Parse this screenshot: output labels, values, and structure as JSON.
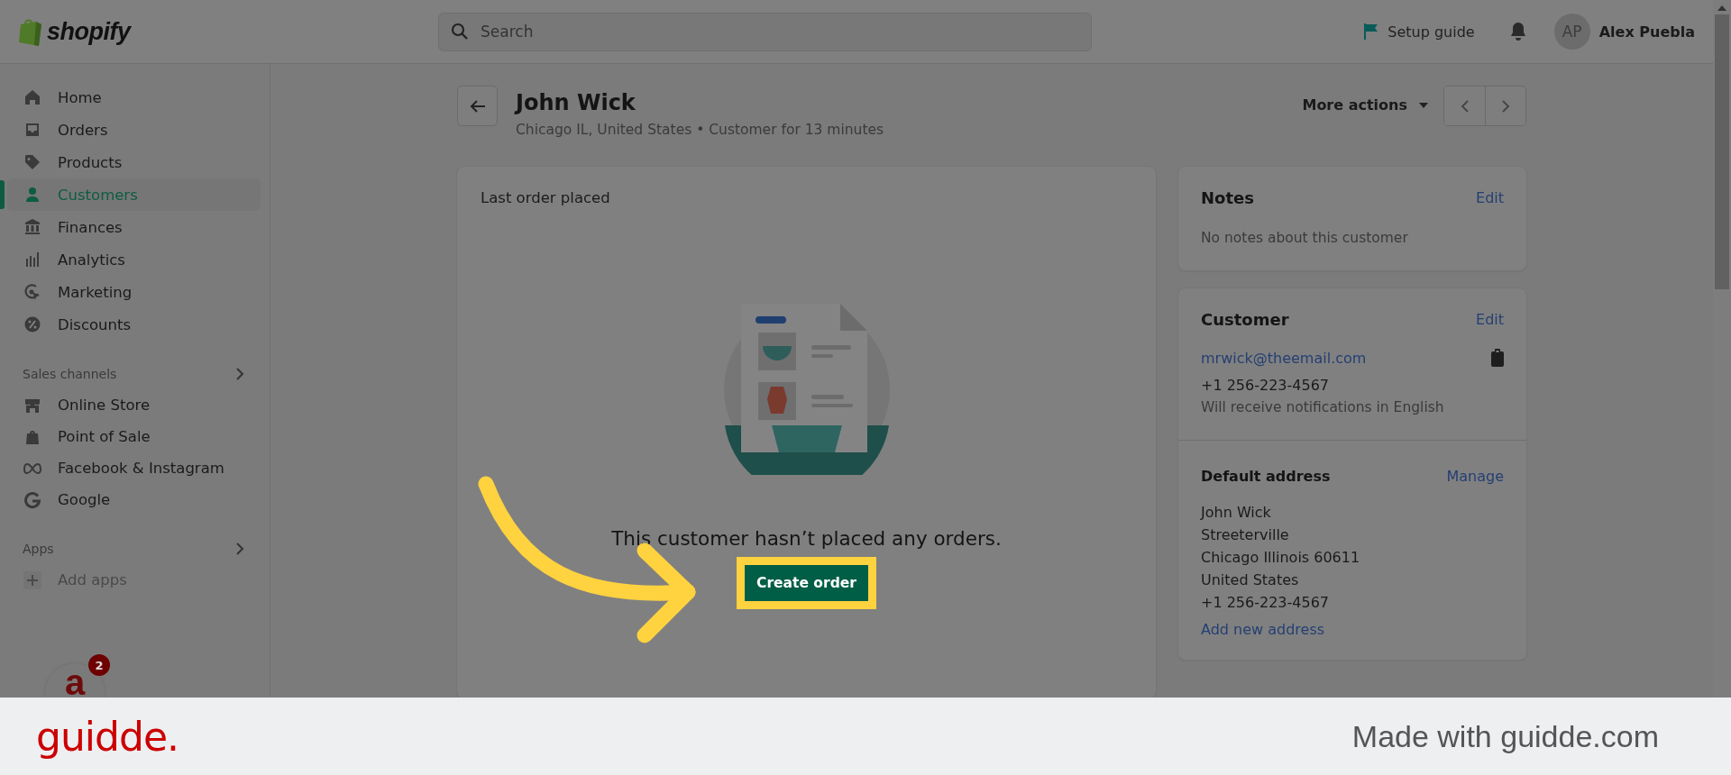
{
  "top_bar": {
    "logo": "shopify",
    "search": {
      "placeholder": "Search"
    },
    "setup_guide": "Setup guide",
    "user": {
      "initials": "AP",
      "name": "Alex Puebla"
    }
  },
  "sidebar": {
    "items": [
      {
        "label": "Home",
        "selected": false
      },
      {
        "label": "Orders",
        "selected": false
      },
      {
        "label": "Products",
        "selected": false
      },
      {
        "label": "Customers",
        "selected": true
      },
      {
        "label": "Finances",
        "selected": false
      },
      {
        "label": "Analytics",
        "selected": false
      },
      {
        "label": "Marketing",
        "selected": false
      },
      {
        "label": "Discounts",
        "selected": false
      }
    ],
    "sections": [
      {
        "title": "Sales channels",
        "items": [
          {
            "label": "Online Store",
            "kind": "link"
          },
          {
            "label": "Point of Sale",
            "kind": "link"
          },
          {
            "label": "Facebook & Instagram",
            "kind": "link"
          },
          {
            "label": "Google",
            "kind": "link"
          }
        ]
      },
      {
        "title": "Apps",
        "items": [
          {
            "label": "Add apps",
            "kind": "add"
          }
        ]
      }
    ]
  },
  "page_header": {
    "title": "John Wick",
    "subtitle": "Chicago IL, United States • Customer for 13 minutes",
    "more_actions": "More actions"
  },
  "last_order": {
    "title": "Last order placed",
    "empty_text": "This customer hasn’t placed any orders.",
    "button": "Create order"
  },
  "notes": {
    "title": "Notes",
    "action": "Edit",
    "text": "No notes about this customer"
  },
  "customer": {
    "title": "Customer",
    "action": "Edit",
    "email": "mrwick@theemail.com",
    "phone": "+1 256-223-4567",
    "language_note": "Will receive notifications in English",
    "default_address": {
      "title": "Default address",
      "action": "Manage",
      "lines": [
        "John Wick",
        "Streeterville",
        "Chicago Illinois 60611",
        "United States",
        "+1 256-223-4567"
      ],
      "add_link": "Add new address"
    }
  },
  "launcher": {
    "glyph": "a",
    "badge": "2"
  },
  "footer": {
    "logo": "guidde.",
    "credit": "Made with guidde.com"
  }
}
